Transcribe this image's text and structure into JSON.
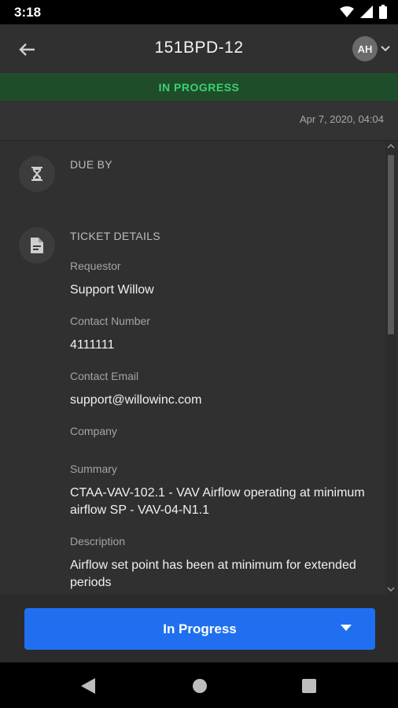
{
  "status_bar": {
    "time": "3:18",
    "icons": [
      "wifi-icon",
      "signal-icon",
      "battery-icon"
    ]
  },
  "header": {
    "back_icon": "arrow-left-icon",
    "title": "151BPD-12",
    "avatar_initials": "AH",
    "avatar_menu_icon": "chevron-down-icon"
  },
  "banner": {
    "status": "IN PROGRESS",
    "text_color": "#3bd16f",
    "bg_color": "#1f4d2a"
  },
  "date": "Apr 7, 2020, 04:04",
  "sections": {
    "due_by": {
      "icon": "hourglass-icon",
      "heading": "DUE BY"
    },
    "ticket_details": {
      "icon": "document-icon",
      "heading": "TICKET DETAILS",
      "fields": {
        "requestor": {
          "label": "Requestor",
          "value": "Support Willow"
        },
        "contact_number": {
          "label": "Contact Number",
          "value": "4111111"
        },
        "contact_email": {
          "label": "Contact Email",
          "value": "support@willowinc.com"
        },
        "company": {
          "label": "Company",
          "value": ""
        },
        "summary": {
          "label": "Summary",
          "value": "CTAA-VAV-102.1 - VAV Airflow operating at minimum airflow SP - VAV-04-N1.1"
        },
        "description": {
          "label": "Description",
          "value": "Airflow set point has been at minimum for extended periods"
        }
      }
    }
  },
  "footer": {
    "status_button_label": "In Progress",
    "button_color": "#1f6ff0",
    "dropdown_icon": "caret-down-icon"
  },
  "nav": {
    "back": "nav-back-icon",
    "home": "nav-home-icon",
    "recents": "nav-recents-icon"
  }
}
